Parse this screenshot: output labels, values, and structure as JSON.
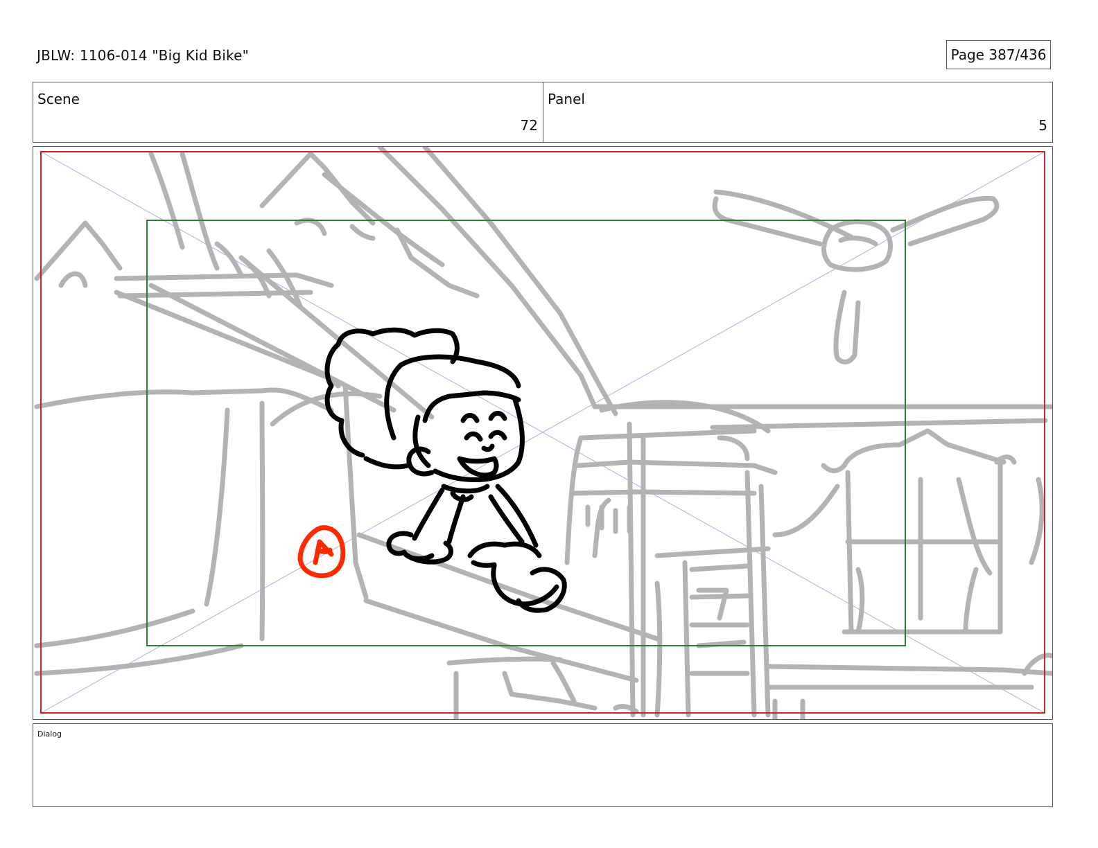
{
  "header": {
    "title": "JBLW: 1106-014 \"Big Kid Bike\"",
    "page": "Page 387/436"
  },
  "info": {
    "scene_label": "Scene",
    "scene_value": "72",
    "panel_label": "Panel",
    "panel_value": "5"
  },
  "frame": {
    "action_marker": "A",
    "colors": {
      "safe_frame": "#c0282d",
      "action_safe": "#2e7d32",
      "diagonals": "#b9b9e8",
      "background_sketch": "#b3b3b3",
      "character_ink": "#000000",
      "marker": "#ff2a00"
    }
  },
  "dialog": {
    "label": "Dialog"
  }
}
